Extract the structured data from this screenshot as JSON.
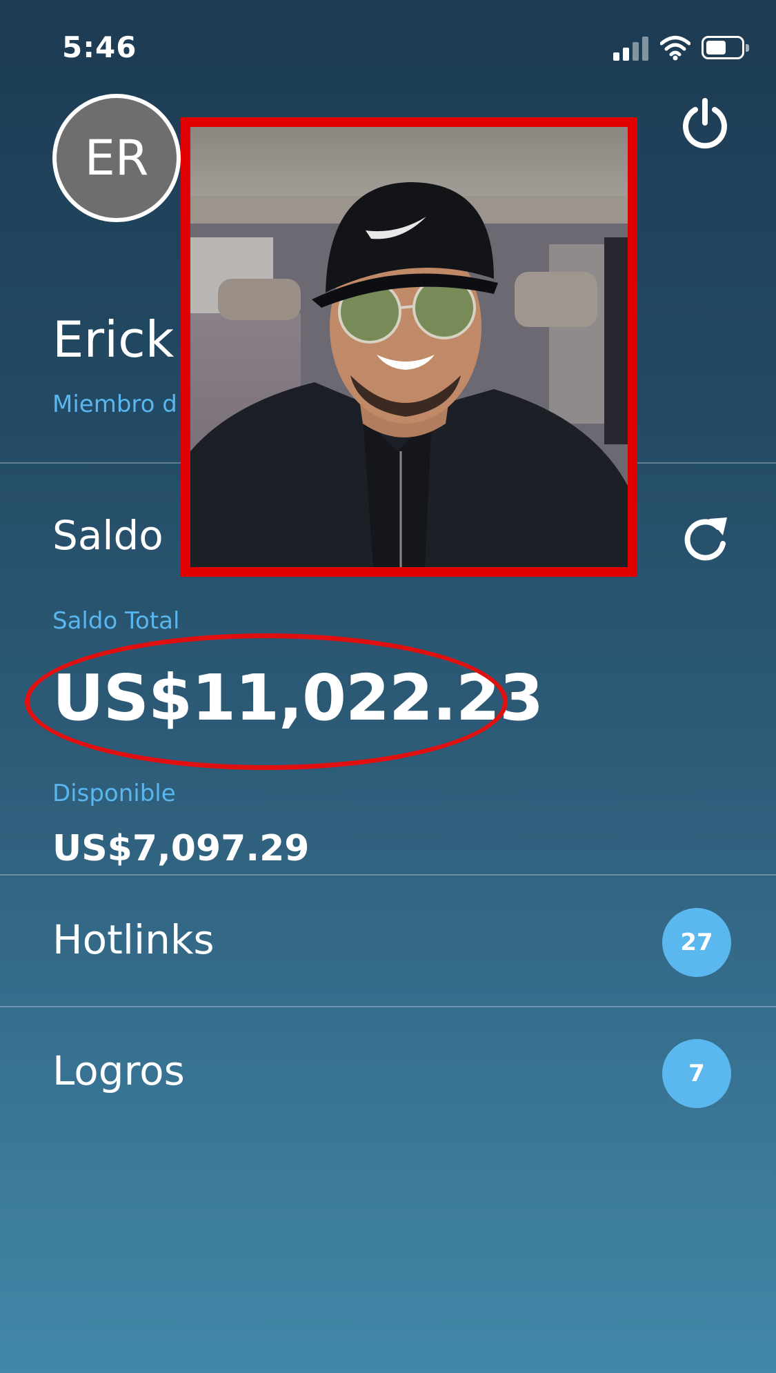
{
  "status_bar": {
    "time": "5:46"
  },
  "profile": {
    "initials": "ER",
    "name": "Erick",
    "member_since": "Miembro d"
  },
  "balance": {
    "title": "Saldo",
    "total_label": "Saldo Total",
    "total_amount": "US$11,022.23",
    "available_label": "Disponible",
    "available_amount": "US$7,097.29"
  },
  "menu": [
    {
      "label": "Hotlinks",
      "count": "27"
    },
    {
      "label": "Logros",
      "count": "7"
    }
  ],
  "colors": {
    "accent_blue": "#5ab6ee",
    "annotation_red": "#e01010",
    "badge_blue": "#5bb8ef"
  },
  "icons": {
    "power": "power-icon",
    "refresh": "refresh-icon",
    "signal": "signal-icon",
    "wifi": "wifi-icon",
    "battery": "battery-icon"
  }
}
